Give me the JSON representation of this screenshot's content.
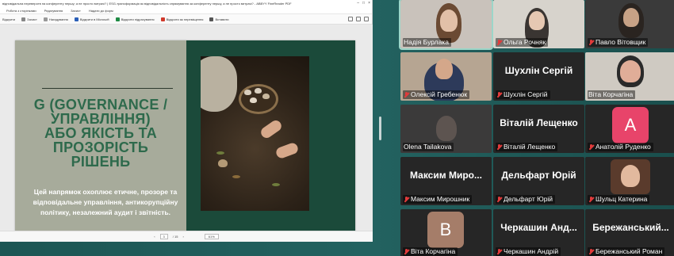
{
  "pdf": {
    "title": "відповідальна переверотв на конференту першу; а не просто витрачі? | ESG-трансформація як відповідальність спрямування за конференту першу, а не просто витрачі? - ABBYY FineReader PDF",
    "menu": [
      "Робота з сторінками",
      "Редагування",
      "Захист",
      "Надати до форм"
    ],
    "toolbar": {
      "open_label": "Відкрити",
      "items": [
        {
          "label": "Захист",
          "icon": "shield-icon"
        },
        {
          "label": "Нагадування",
          "icon": "bell-icon"
        },
        {
          "label": "Відкрити в Microsoft",
          "icon": "word-icon"
        },
        {
          "label": "Відкрити підрахування",
          "icon": "excel-icon"
        },
        {
          "label": "Відкрити як переміщення",
          "icon": "pdf-icon"
        },
        {
          "label": "Вставити",
          "icon": "insert-icon"
        }
      ]
    },
    "slide": {
      "title_lines": [
        "G (GOVERNANCE /",
        "УПРАВЛІННЯ)",
        "АБО ЯКІСТЬ ТА",
        "ПРОЗОРІСТЬ",
        "РІШЕНЬ"
      ],
      "body": "Цей напрямок охоплює етичне, прозоре та відповідальне управління, антикорупційну політику, незалежний аудит і звітність."
    },
    "status": {
      "page_current": "3",
      "page_total": "/ 15",
      "zoom": "61%"
    },
    "colors": {
      "slide_left": "#a7ab9b",
      "title_green": "#2e6a4c",
      "photo_bg": "#1b4a3a"
    }
  },
  "participants": [
    {
      "name": "Надія Бурлака",
      "type": "video",
      "muted": false,
      "active": true
    },
    {
      "name": "Ольга Рочняк",
      "type": "video",
      "muted": true
    },
    {
      "name": "Павло Вітовщик",
      "type": "video",
      "muted": true
    },
    {
      "name": "Олексій Гребенюк",
      "type": "video",
      "muted": true
    },
    {
      "name": "Шухлін Сергій",
      "big": "Шухлін Сергій",
      "type": "text",
      "muted": true
    },
    {
      "name": "Віта Корчагіна",
      "type": "video",
      "muted": false
    },
    {
      "name": "Olena Tailakova",
      "type": "video",
      "muted": false
    },
    {
      "name": "Віталій Лещенко",
      "big": "Віталій Лещенко",
      "type": "text",
      "muted": true
    },
    {
      "name": "Анатолій Руденко",
      "letter": "А",
      "letter_color": "#e8446a",
      "type": "letter",
      "muted": true
    },
    {
      "name": "Максим Мирошник",
      "big": "Максим Миро...",
      "type": "text",
      "muted": true
    },
    {
      "name": "Дельфарт Юрій",
      "big": "Дельфарт Юрій",
      "type": "text",
      "muted": true
    },
    {
      "name": "Шульц Катерина",
      "type": "video",
      "muted": true
    },
    {
      "name": "Віта Корчагіна",
      "letter": "В",
      "letter_color": "#a57d69",
      "type": "letter",
      "muted": true
    },
    {
      "name": "Черкашин Андрій",
      "big": "Черкашин Анд...",
      "type": "text",
      "muted": true
    },
    {
      "name": "Бережанський Роман",
      "big": "Бережанський...",
      "type": "text",
      "muted": true
    }
  ]
}
